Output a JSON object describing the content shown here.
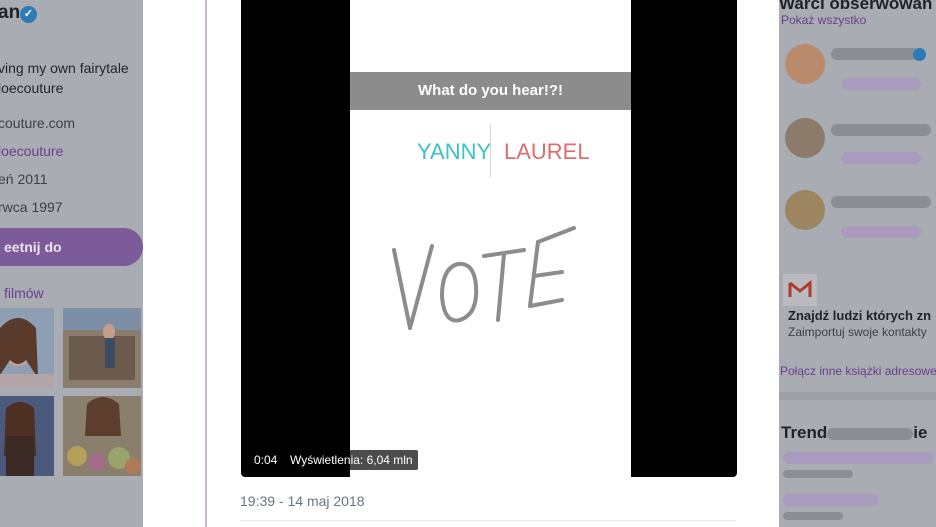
{
  "profile": {
    "name_fragment": "an",
    "bio": "ving my own fairytale\nloecouture",
    "website": "couture.com",
    "handle_link": "loecouture",
    "joined": "eń 2011",
    "birthday": "rwca 1997",
    "tweet_button": "eetnij do",
    "media_label": "filmów",
    "colors": {
      "accent": "#7c5b99",
      "link": "#6b3e8c"
    }
  },
  "video": {
    "question": "What do you hear!?!",
    "option_a": "YANNY",
    "option_b": "LAUREL",
    "handwritten": "VOTE",
    "elapsed": "0:04",
    "views": "Wyświetlenia: 6,04 mln",
    "colors": {
      "option_a": "#3cc2c6",
      "option_b": "#e06a72"
    }
  },
  "tweet": {
    "timestamp": "19:39 - 14 maj 2018"
  },
  "sidebar": {
    "who_to_follow": "Warci obserwowan",
    "show_all": "Pokaż wszystko",
    "find_people_title": "Znajdź ludzi których zn",
    "find_people_sub": "Zaimportuj swoje kontakty",
    "connect_other": "Połącz inne książki adresowe",
    "trends_title": "Trend",
    "trends_suffix": "ie",
    "gmail_icon": "gmail-icon"
  }
}
